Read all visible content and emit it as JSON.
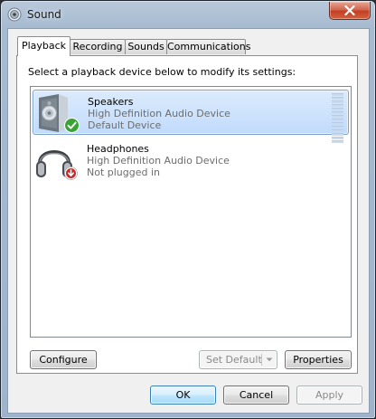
{
  "window": {
    "title": "Sound",
    "icon": "speaker-icon"
  },
  "tabs": [
    {
      "label": "Playback",
      "active": true
    },
    {
      "label": "Recording",
      "active": false
    },
    {
      "label": "Sounds",
      "active": false
    },
    {
      "label": "Communications",
      "active": false
    }
  ],
  "playback": {
    "instruction": "Select a playback device below to modify its settings:",
    "devices": [
      {
        "name": "Speakers",
        "driver": "High Definition Audio Device",
        "status": "Default Device",
        "icon": "speakers-icon",
        "badge": "green-check-icon",
        "selected": true
      },
      {
        "name": "Headphones",
        "driver": "High Definition Audio Device",
        "status": "Not plugged in",
        "icon": "headphones-icon",
        "badge": "red-down-arrow-icon",
        "selected": false
      }
    ],
    "configure_label": "Configure",
    "set_default_label": "Set Default",
    "properties_label": "Properties"
  },
  "footer": {
    "ok_label": "OK",
    "cancel_label": "Cancel",
    "apply_label": "Apply"
  },
  "colors": {
    "selection": "#c1dbfc",
    "default_badge": "#3aa335",
    "unplugged_badge": "#c62b2b"
  }
}
